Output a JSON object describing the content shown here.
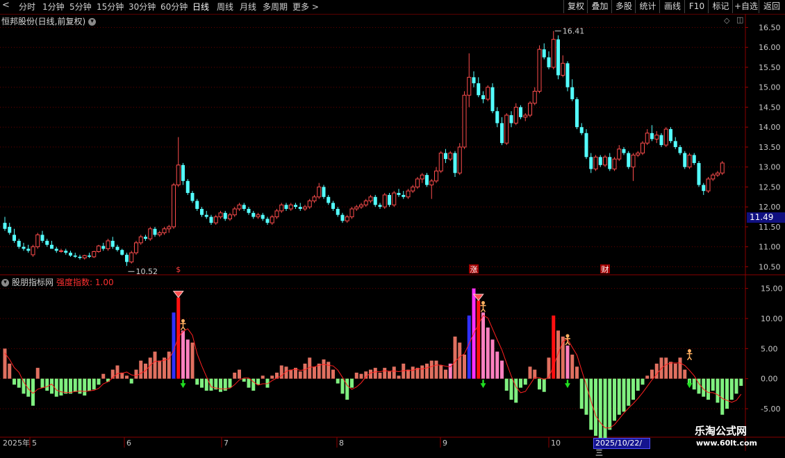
{
  "toolbar": {
    "periods": [
      "分时",
      "1分钟",
      "5分钟",
      "15分钟",
      "30分钟",
      "60分钟",
      "日线",
      "周线",
      "月线",
      "多周期",
      "更多 >"
    ],
    "active_period": "日线",
    "buttons": [
      "复权",
      "叠加",
      "多股",
      "统计",
      "画线",
      "F10",
      "标记",
      "+自选",
      "返回"
    ]
  },
  "title": {
    "stock": "恒邦股份(日线,前复权)"
  },
  "indicator": {
    "name": "股朋指标网",
    "label": "强度指数: 1.00"
  },
  "price_label": "11.49",
  "selected_date": "2025/10/22/三",
  "watermark": {
    "cn": "乐淘公式网",
    "url": "www.60lt.com"
  },
  "markers": [
    "$",
    "涨",
    "财"
  ],
  "colors": {
    "up": "#ff4d4d",
    "down": "#54ffff",
    "hist_pos": "#e07060",
    "hist_neg": "#80f080",
    "hist_pink": "#ff80c0",
    "hist_red": "#ff1010",
    "hist_magenta": "#ff30ff",
    "hist_blue": "#3030ff",
    "line": "#ff2020",
    "grid": "#6a0000"
  },
  "chart_data": [
    {
      "type": "candlestick",
      "title": "恒邦股份(日线,前复权)",
      "y_axis": {
        "ticks": [
          "16.50",
          "16.00",
          "15.50",
          "15.00",
          "14.50",
          "14.00",
          "13.50",
          "13.00",
          "12.50",
          "12.00",
          "11.50",
          "11.00",
          "10.50"
        ],
        "range": [
          10.35,
          16.7
        ]
      },
      "x_axis": {
        "labels": [
          "2025年",
          "5",
          "6",
          "7",
          "8",
          "9",
          "10"
        ]
      },
      "annotations": [
        {
          "text": "16.41",
          "value": 16.41
        },
        {
          "text": "10.52",
          "value": 10.52
        }
      ],
      "ohlc": [
        [
          11.6,
          11.75,
          11.4,
          11.45
        ],
        [
          11.5,
          11.6,
          11.3,
          11.35
        ],
        [
          11.3,
          11.45,
          11.1,
          11.15
        ],
        [
          11.15,
          11.2,
          10.95,
          11.0
        ],
        [
          11.0,
          11.1,
          10.9,
          10.95
        ],
        [
          10.95,
          11.05,
          10.85,
          10.9
        ],
        [
          10.8,
          11.05,
          10.75,
          11.0
        ],
        [
          11.0,
          11.35,
          10.95,
          11.3
        ],
        [
          11.3,
          11.4,
          11.1,
          11.15
        ],
        [
          11.15,
          11.2,
          11.0,
          11.05
        ],
        [
          11.05,
          11.15,
          10.95,
          10.95
        ],
        [
          10.95,
          11.0,
          10.85,
          10.9
        ],
        [
          10.9,
          10.95,
          10.85,
          10.9
        ],
        [
          10.9,
          10.95,
          10.8,
          10.85
        ],
        [
          10.85,
          10.9,
          10.75,
          10.78
        ],
        [
          10.78,
          10.85,
          10.72,
          10.75
        ],
        [
          10.75,
          10.8,
          10.68,
          10.72
        ],
        [
          10.72,
          10.8,
          10.68,
          10.78
        ],
        [
          10.78,
          10.85,
          10.72,
          10.75
        ],
        [
          10.75,
          10.9,
          10.72,
          10.88
        ],
        [
          10.88,
          11.05,
          10.85,
          11.02
        ],
        [
          11.02,
          11.1,
          10.9,
          10.95
        ],
        [
          10.95,
          11.2,
          10.9,
          11.15
        ],
        [
          11.15,
          11.25,
          10.95,
          11.0
        ],
        [
          11.0,
          11.05,
          10.88,
          10.92
        ],
        [
          10.92,
          10.95,
          10.78,
          10.8
        ],
        [
          10.8,
          10.85,
          10.52,
          10.62
        ],
        [
          10.62,
          10.9,
          10.58,
          10.85
        ],
        [
          10.85,
          11.15,
          10.8,
          11.1
        ],
        [
          11.1,
          11.3,
          11.05,
          11.25
        ],
        [
          11.25,
          11.3,
          11.15,
          11.2
        ],
        [
          11.2,
          11.5,
          11.15,
          11.45
        ],
        [
          11.45,
          11.5,
          11.25,
          11.3
        ],
        [
          11.3,
          11.4,
          11.25,
          11.35
        ],
        [
          11.35,
          11.5,
          11.3,
          11.45
        ],
        [
          11.45,
          11.55,
          11.35,
          11.5
        ],
        [
          11.5,
          12.6,
          11.45,
          12.55
        ],
        [
          12.55,
          13.75,
          12.5,
          13.05
        ],
        [
          13.05,
          13.1,
          12.55,
          12.65
        ],
        [
          12.65,
          12.7,
          12.3,
          12.35
        ],
        [
          12.35,
          12.4,
          12.1,
          12.15
        ],
        [
          12.15,
          12.2,
          11.9,
          11.95
        ],
        [
          11.95,
          12.0,
          11.75,
          11.8
        ],
        [
          11.8,
          11.9,
          11.7,
          11.75
        ],
        [
          11.75,
          11.8,
          11.55,
          11.6
        ],
        [
          11.6,
          11.8,
          11.55,
          11.75
        ],
        [
          11.75,
          11.9,
          11.7,
          11.85
        ],
        [
          11.85,
          11.9,
          11.65,
          11.7
        ],
        [
          11.7,
          11.85,
          11.65,
          11.8
        ],
        [
          11.8,
          12.0,
          11.75,
          11.95
        ],
        [
          11.95,
          12.1,
          11.9,
          12.05
        ],
        [
          12.05,
          12.1,
          11.9,
          11.95
        ],
        [
          11.95,
          12.0,
          11.8,
          11.85
        ],
        [
          11.85,
          11.9,
          11.7,
          11.75
        ],
        [
          11.75,
          11.85,
          11.7,
          11.8
        ],
        [
          11.8,
          11.85,
          11.65,
          11.7
        ],
        [
          11.7,
          11.75,
          11.55,
          11.6
        ],
        [
          11.6,
          11.8,
          11.55,
          11.75
        ],
        [
          11.75,
          11.95,
          11.7,
          11.9
        ],
        [
          11.9,
          12.1,
          11.85,
          12.05
        ],
        [
          12.05,
          12.1,
          11.9,
          11.95
        ],
        [
          11.95,
          12.1,
          11.9,
          12.05
        ],
        [
          12.05,
          12.1,
          11.95,
          12.0
        ],
        [
          12.0,
          12.1,
          11.9,
          11.95
        ],
        [
          11.95,
          12.05,
          11.9,
          12.0
        ],
        [
          12.0,
          12.2,
          11.95,
          12.15
        ],
        [
          12.15,
          12.3,
          12.1,
          12.25
        ],
        [
          12.25,
          12.6,
          12.2,
          12.5
        ],
        [
          12.5,
          12.55,
          12.2,
          12.25
        ],
        [
          12.25,
          12.3,
          12.05,
          12.1
        ],
        [
          12.1,
          12.15,
          11.9,
          11.95
        ],
        [
          11.95,
          12.0,
          11.75,
          11.8
        ],
        [
          11.8,
          11.85,
          11.6,
          11.65
        ],
        [
          11.65,
          11.8,
          11.6,
          11.75
        ],
        [
          11.75,
          12.0,
          11.7,
          11.95
        ],
        [
          11.95,
          12.05,
          11.9,
          12.0
        ],
        [
          12.0,
          12.1,
          11.95,
          12.05
        ],
        [
          12.05,
          12.2,
          12.0,
          12.15
        ],
        [
          12.15,
          12.3,
          12.1,
          12.25
        ],
        [
          12.25,
          12.3,
          12.0,
          12.05
        ],
        [
          12.05,
          12.1,
          11.95,
          12.0
        ],
        [
          12.0,
          12.35,
          11.95,
          12.3
        ],
        [
          12.3,
          12.35,
          12.0,
          12.05
        ],
        [
          12.05,
          12.4,
          12.0,
          12.35
        ],
        [
          12.35,
          12.45,
          12.25,
          12.3
        ],
        [
          12.3,
          12.4,
          12.2,
          12.25
        ],
        [
          12.25,
          12.45,
          12.2,
          12.4
        ],
        [
          12.4,
          12.55,
          12.35,
          12.5
        ],
        [
          12.5,
          12.75,
          12.45,
          12.7
        ],
        [
          12.7,
          12.85,
          12.6,
          12.8
        ],
        [
          12.8,
          12.85,
          12.5,
          12.55
        ],
        [
          12.55,
          12.7,
          12.2,
          12.65
        ],
        [
          12.65,
          13.0,
          12.6,
          12.9
        ],
        [
          12.9,
          13.4,
          12.85,
          13.35
        ],
        [
          13.35,
          13.45,
          13.1,
          13.2
        ],
        [
          13.2,
          13.4,
          13.15,
          13.35
        ],
        [
          13.35,
          13.4,
          12.75,
          12.85
        ],
        [
          12.85,
          13.6,
          12.8,
          13.5
        ],
        [
          13.5,
          14.9,
          13.45,
          14.8
        ],
        [
          14.8,
          15.85,
          14.5,
          15.25
        ],
        [
          15.25,
          15.4,
          15.0,
          15.1
        ],
        [
          15.1,
          15.25,
          14.75,
          14.8
        ],
        [
          14.8,
          14.9,
          14.6,
          14.7
        ],
        [
          14.7,
          15.05,
          14.65,
          15.0
        ],
        [
          15.0,
          15.1,
          14.35,
          14.4
        ],
        [
          14.4,
          14.5,
          14.0,
          14.1
        ],
        [
          14.1,
          14.25,
          13.55,
          13.6
        ],
        [
          13.6,
          14.35,
          13.55,
          14.3
        ],
        [
          14.3,
          14.4,
          14.0,
          14.1
        ],
        [
          14.1,
          14.6,
          14.05,
          14.5
        ],
        [
          14.5,
          14.55,
          14.2,
          14.25
        ],
        [
          14.25,
          14.35,
          14.15,
          14.3
        ],
        [
          14.3,
          14.65,
          14.25,
          14.6
        ],
        [
          14.6,
          15.0,
          14.55,
          14.9
        ],
        [
          14.9,
          16.05,
          14.85,
          15.95
        ],
        [
          15.95,
          16.1,
          15.7,
          15.75
        ],
        [
          15.75,
          15.9,
          15.45,
          15.5
        ],
        [
          15.5,
          16.41,
          15.45,
          16.2
        ],
        [
          16.2,
          16.3,
          15.2,
          15.3
        ],
        [
          15.3,
          15.8,
          15.25,
          15.6
        ],
        [
          15.6,
          15.65,
          14.9,
          15.0
        ],
        [
          15.0,
          15.2,
          14.65,
          14.7
        ],
        [
          14.7,
          14.75,
          13.95,
          14.0
        ],
        [
          14.0,
          14.1,
          13.8,
          13.85
        ],
        [
          13.85,
          13.95,
          13.2,
          13.25
        ],
        [
          13.25,
          13.35,
          12.85,
          12.95
        ],
        [
          12.95,
          13.3,
          12.9,
          13.25
        ],
        [
          13.25,
          13.3,
          13.0,
          13.05
        ],
        [
          13.05,
          13.3,
          13.0,
          13.25
        ],
        [
          13.25,
          13.35,
          12.9,
          12.95
        ],
        [
          12.95,
          13.25,
          12.9,
          13.2
        ],
        [
          13.2,
          13.55,
          13.15,
          13.45
        ],
        [
          13.45,
          13.5,
          13.3,
          13.35
        ],
        [
          13.35,
          13.4,
          12.95,
          13.0
        ],
        [
          13.0,
          13.35,
          12.65,
          13.3
        ],
        [
          13.3,
          13.4,
          13.25,
          13.35
        ],
        [
          13.35,
          13.65,
          13.3,
          13.6
        ],
        [
          13.6,
          13.95,
          13.55,
          13.85
        ],
        [
          13.85,
          14.05,
          13.65,
          13.7
        ],
        [
          13.7,
          13.9,
          13.6,
          13.8
        ],
        [
          13.8,
          13.85,
          13.5,
          13.55
        ],
        [
          13.55,
          14.0,
          13.5,
          13.95
        ],
        [
          13.95,
          14.0,
          13.6,
          13.65
        ],
        [
          13.65,
          13.75,
          13.45,
          13.5
        ],
        [
          13.5,
          13.55,
          13.3,
          13.35
        ],
        [
          13.35,
          13.4,
          12.95,
          13.0
        ],
        [
          13.0,
          13.35,
          12.95,
          13.3
        ],
        [
          13.3,
          13.35,
          13.05,
          13.1
        ],
        [
          13.1,
          13.15,
          12.5,
          12.55
        ],
        [
          12.55,
          12.6,
          12.3,
          12.4
        ],
        [
          12.4,
          12.75,
          12.35,
          12.7
        ],
        [
          12.7,
          12.85,
          12.65,
          12.8
        ],
        [
          12.8,
          12.9,
          12.75,
          12.85
        ],
        [
          12.85,
          13.15,
          12.8,
          13.1
        ]
      ]
    },
    {
      "type": "bar",
      "title": "股朋指标网",
      "y_axis": {
        "ticks": [
          "15.00",
          "10.00",
          "5.00",
          "0.00",
          "-5.00"
        ],
        "range": [
          -9.5,
          16
        ]
      },
      "series": [
        {
          "name": "强度指数",
          "values": [
            5,
            2.5,
            -1,
            -1.5,
            -2.5,
            -3,
            -4.5,
            1.8,
            -1.5,
            -2,
            -2.5,
            -3,
            -2.8,
            -2.5,
            -2.5,
            -2.2,
            -2.5,
            -2.8,
            -2,
            -1.8,
            -1,
            0.8,
            -0.5,
            1.5,
            2.2,
            1,
            0.5,
            -0.8,
            1.5,
            3,
            2.5,
            3.5,
            4.5,
            3,
            3.5,
            4.5,
            11,
            13.5,
            8,
            6.5,
            6,
            -1,
            -1.5,
            -2,
            -2,
            -1.8,
            -2.2,
            -2,
            -1.5,
            1,
            1.5,
            -0.5,
            -1.5,
            -2,
            -1,
            0.5,
            -1.5,
            0.5,
            1,
            2.2,
            2,
            1.5,
            1.8,
            1.2,
            2.5,
            3.5,
            2,
            2.5,
            3.2,
            2.8,
            1.5,
            -0.8,
            -2.5,
            -3.5,
            -1.5,
            1,
            0.8,
            1.2,
            1.5,
            1.8,
            1,
            1.8,
            1.2,
            2,
            0.5,
            2.5,
            1.5,
            2,
            1.8,
            2.2,
            2.5,
            3,
            3,
            2.2,
            1.5,
            2.5,
            7,
            6,
            4,
            10.5,
            15,
            13,
            11,
            8.5,
            6.5,
            4.5,
            3,
            -2,
            -3.5,
            -4,
            -1.5,
            -1,
            2,
            1.5,
            -1.8,
            -2.2,
            3.5,
            10.5,
            8,
            7,
            5.5,
            4,
            2,
            -5,
            -6,
            -8.5,
            -9.5,
            -10.5,
            -10,
            -8.5,
            -7,
            -6,
            -5.5,
            -4.5,
            -3.5,
            -2,
            -1,
            0.5,
            1.5,
            2.5,
            3.5,
            3.5,
            2.8,
            2.5,
            3.5,
            1.5,
            -1,
            -1.8,
            -2.5,
            -3,
            -3.5,
            -2,
            -4,
            -6,
            -5,
            -3.5,
            -2.5,
            -1.2
          ]
        }
      ],
      "signals": {
        "diamond": [
          "candle 37",
          "candle 101"
        ],
        "figure": [
          "candle 38",
          "candle 102",
          "candle 120",
          "candle 146"
        ],
        "down_arrow": [
          "candle 38",
          "candle 102",
          "candle 120",
          "candle 146"
        ]
      }
    }
  ]
}
